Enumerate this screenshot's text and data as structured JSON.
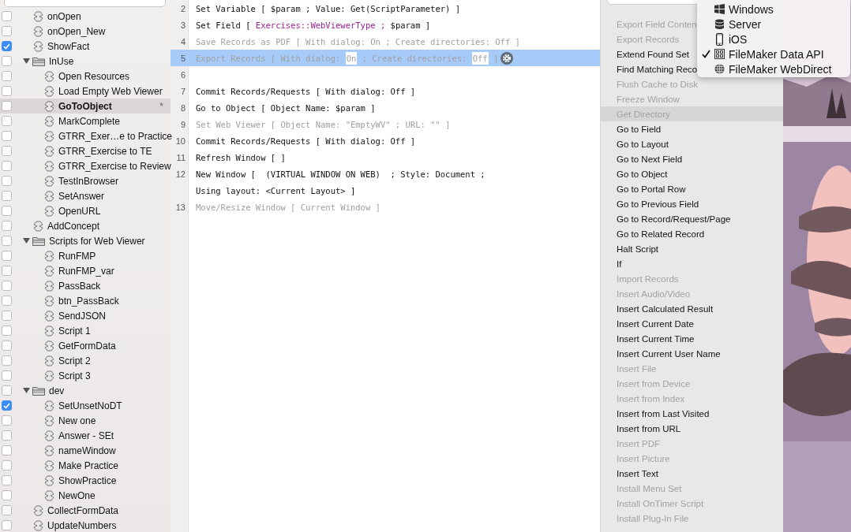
{
  "sidebar": {
    "items": [
      {
        "kind": "script",
        "name": "onOpen",
        "checked": false,
        "selected": false
      },
      {
        "kind": "script",
        "name": "onOpen_New",
        "checked": false,
        "selected": false
      },
      {
        "kind": "script",
        "name": "ShowFact",
        "checked": true,
        "selected": false
      },
      {
        "kind": "folder",
        "name": "InUse",
        "checked": false,
        "selected": false,
        "expanded": true,
        "children": [
          {
            "kind": "script",
            "name": "Open Resources",
            "checked": false,
            "selected": false
          },
          {
            "kind": "script",
            "name": "Load Empty Web Viewer",
            "checked": false,
            "selected": false
          },
          {
            "kind": "script",
            "name": "GoToObject",
            "checked": false,
            "selected": true,
            "marker": "*"
          },
          {
            "kind": "script",
            "name": "MarkComplete",
            "checked": false,
            "selected": false
          },
          {
            "kind": "script",
            "name": "GTRR_Exer…e to Practice",
            "checked": false,
            "selected": false
          },
          {
            "kind": "script",
            "name": "GTRR_Exercise to TE",
            "checked": false,
            "selected": false
          },
          {
            "kind": "script",
            "name": "GTRR_Exercise to Review",
            "checked": false,
            "selected": false
          },
          {
            "kind": "script",
            "name": "TestInBrowser",
            "checked": false,
            "selected": false
          },
          {
            "kind": "script",
            "name": "SetAnswer",
            "checked": false,
            "selected": false
          },
          {
            "kind": "script",
            "name": "OpenURL",
            "checked": false,
            "selected": false
          }
        ]
      },
      {
        "kind": "script",
        "name": "AddConcept",
        "checked": false,
        "selected": false
      },
      {
        "kind": "folder",
        "name": "Scripts for Web Viewer",
        "checked": false,
        "selected": false,
        "expanded": true,
        "children": [
          {
            "kind": "script",
            "name": "RunFMP",
            "checked": false,
            "selected": false
          },
          {
            "kind": "script",
            "name": "RunFMP_var",
            "checked": false,
            "selected": false
          },
          {
            "kind": "script",
            "name": "PassBack",
            "checked": false,
            "selected": false
          },
          {
            "kind": "script",
            "name": "btn_PassBack",
            "checked": false,
            "selected": false
          },
          {
            "kind": "script",
            "name": "SendJSON",
            "checked": false,
            "selected": false
          },
          {
            "kind": "script",
            "name": "Script 1",
            "checked": false,
            "selected": false
          },
          {
            "kind": "script",
            "name": "GetFormData",
            "checked": false,
            "selected": false
          },
          {
            "kind": "script",
            "name": "Script 2",
            "checked": false,
            "selected": false
          },
          {
            "kind": "script",
            "name": "Script 3",
            "checked": false,
            "selected": false
          }
        ]
      },
      {
        "kind": "folder",
        "name": "dev",
        "checked": false,
        "selected": false,
        "expanded": true,
        "children": [
          {
            "kind": "script",
            "name": "SetUnsetNoDT",
            "checked": true,
            "selected": false
          },
          {
            "kind": "script",
            "name": "New one",
            "checked": false,
            "selected": false
          },
          {
            "kind": "script",
            "name": "Answer - SEt",
            "checked": false,
            "selected": false
          },
          {
            "kind": "script",
            "name": "nameWindow",
            "checked": false,
            "selected": false
          },
          {
            "kind": "script",
            "name": "Make Practice",
            "checked": false,
            "selected": false
          },
          {
            "kind": "script",
            "name": "ShowPractice",
            "checked": false,
            "selected": false
          },
          {
            "kind": "script",
            "name": "NewOne",
            "checked": false,
            "selected": false
          }
        ]
      },
      {
        "kind": "script",
        "name": "CollectFormData",
        "checked": false,
        "selected": false
      },
      {
        "kind": "script",
        "name": "UpdateNumbers",
        "checked": false,
        "selected": false
      }
    ]
  },
  "editor": {
    "steps": [
      {
        "number": "2",
        "disabled": false,
        "selected": false,
        "lines": [
          [
            {
              "kind": "plain",
              "text": "Set Variable [ $param ; Value: Get(ScriptParameter) ]"
            }
          ]
        ]
      },
      {
        "number": "3",
        "disabled": false,
        "selected": false,
        "lines": [
          [
            {
              "kind": "plain",
              "text": "Set Field [ "
            },
            {
              "kind": "field",
              "text": "Exercises::WebViewerType ;"
            },
            {
              "kind": "plain",
              "text": " $param ]"
            }
          ]
        ]
      },
      {
        "number": "4",
        "disabled": true,
        "selected": false,
        "lines": [
          [
            {
              "kind": "plain",
              "text": "Save Records as PDF [ With dialog: On ; Create directories: Off ]"
            }
          ]
        ]
      },
      {
        "number": "5",
        "disabled": true,
        "selected": true,
        "lines": [
          [
            {
              "kind": "plain",
              "text": "Export Records [ With dialog: "
            },
            {
              "kind": "token",
              "text": "On"
            },
            {
              "kind": "plain",
              "text": " ; Create directories: "
            },
            {
              "kind": "token",
              "text": "Off"
            },
            {
              "kind": "plain",
              "text": " ]"
            }
          ]
        ]
      },
      {
        "number": "6",
        "selected": false
      },
      {
        "number": "7",
        "disabled": false,
        "selected": false,
        "lines": [
          [
            {
              "kind": "plain",
              "text": "Commit Records/Requests [ With dialog: Off ]"
            }
          ]
        ]
      },
      {
        "number": "8",
        "disabled": false,
        "selected": false,
        "lines": [
          [
            {
              "kind": "plain",
              "text": "Go to Object [ Object Name: $param ]"
            }
          ]
        ]
      },
      {
        "number": "9",
        "disabled": true,
        "selected": false,
        "lines": [
          [
            {
              "kind": "plain",
              "text": "Set Web Viewer [ Object Name: \"EmptyWV\" ; URL: \"\" ]"
            }
          ]
        ]
      },
      {
        "number": "10",
        "disabled": false,
        "selected": false,
        "lines": [
          [
            {
              "kind": "plain",
              "text": "Commit Records/Requests [ With dialog: Off ]"
            }
          ]
        ]
      },
      {
        "number": "11",
        "disabled": false,
        "selected": false,
        "lines": [
          [
            {
              "kind": "plain",
              "text": "Refresh Window [ ]"
            }
          ]
        ]
      },
      {
        "number": "12",
        "disabled": false,
        "selected": false,
        "lines": [
          [
            {
              "kind": "plain",
              "text": "New Window [  (VIRTUAL WINDOW ON WEB)  ; Style: Document ;"
            }
          ],
          [
            {
              "kind": "plain",
              "text": "Using layout: <Current Layout> ]"
            }
          ]
        ]
      },
      {
        "number": "13",
        "disabled": true,
        "selected": false,
        "lines": [
          [
            {
              "kind": "plain",
              "text": "Move/Resize Window [ Current Window ]"
            }
          ]
        ]
      }
    ]
  },
  "step_list": {
    "items": [
      {
        "name": "Export Field Conten",
        "disabled": true,
        "selected": false
      },
      {
        "name": "Export Records",
        "disabled": true,
        "selected": false
      },
      {
        "name": "Extend Found Set",
        "disabled": false,
        "selected": false
      },
      {
        "name": "Find Matching Reco",
        "disabled": false,
        "selected": false
      },
      {
        "name": "Flush Cache to Disk",
        "disabled": true,
        "selected": false
      },
      {
        "name": "Freeze Window",
        "disabled": true,
        "selected": false
      },
      {
        "name": "Get Directory",
        "disabled": true,
        "selected": true
      },
      {
        "name": "Go to Field",
        "disabled": false,
        "selected": false
      },
      {
        "name": "Go to Layout",
        "disabled": false,
        "selected": false
      },
      {
        "name": "Go to Next Field",
        "disabled": false,
        "selected": false
      },
      {
        "name": "Go to Object",
        "disabled": false,
        "selected": false
      },
      {
        "name": "Go to Portal Row",
        "disabled": false,
        "selected": false
      },
      {
        "name": "Go to Previous Field",
        "disabled": false,
        "selected": false
      },
      {
        "name": "Go to Record/Request/Page",
        "disabled": false,
        "selected": false
      },
      {
        "name": "Go to Related Record",
        "disabled": false,
        "selected": false
      },
      {
        "name": "Halt Script",
        "disabled": false,
        "selected": false
      },
      {
        "name": "If",
        "disabled": false,
        "selected": false
      },
      {
        "name": "Import Records",
        "disabled": true,
        "selected": false
      },
      {
        "name": "Insert Audio/Video",
        "disabled": true,
        "selected": false
      },
      {
        "name": "Insert Calculated Result",
        "disabled": false,
        "selected": false
      },
      {
        "name": "Insert Current Date",
        "disabled": false,
        "selected": false
      },
      {
        "name": "Insert Current Time",
        "disabled": false,
        "selected": false
      },
      {
        "name": "Insert Current User Name",
        "disabled": false,
        "selected": false
      },
      {
        "name": "Insert File",
        "disabled": true,
        "selected": false
      },
      {
        "name": "Insert from Device",
        "disabled": true,
        "selected": false
      },
      {
        "name": "Insert from Index",
        "disabled": true,
        "selected": false
      },
      {
        "name": "Insert from Last Visited",
        "disabled": false,
        "selected": false
      },
      {
        "name": "Insert from URL",
        "disabled": false,
        "selected": false
      },
      {
        "name": "Insert PDF",
        "disabled": true,
        "selected": false
      },
      {
        "name": "Insert Picture",
        "disabled": true,
        "selected": false
      },
      {
        "name": "Insert Text",
        "disabled": false,
        "selected": false
      },
      {
        "name": "Install Menu Set",
        "disabled": true,
        "selected": false
      },
      {
        "name": "Install OnTimer Script",
        "disabled": true,
        "selected": false
      },
      {
        "name": "Install Plug-In File",
        "disabled": true,
        "selected": false
      }
    ]
  },
  "platform_menu": {
    "items": [
      {
        "kind": "windows",
        "label": "Windows",
        "checked": false
      },
      {
        "kind": "server",
        "label": "Server",
        "checked": false
      },
      {
        "kind": "ios",
        "label": "iOS",
        "checked": false
      },
      {
        "kind": "api",
        "label": "FileMaker Data API",
        "checked": true
      },
      {
        "kind": "web",
        "label": "FileMaker WebDirect",
        "checked": false
      }
    ]
  }
}
